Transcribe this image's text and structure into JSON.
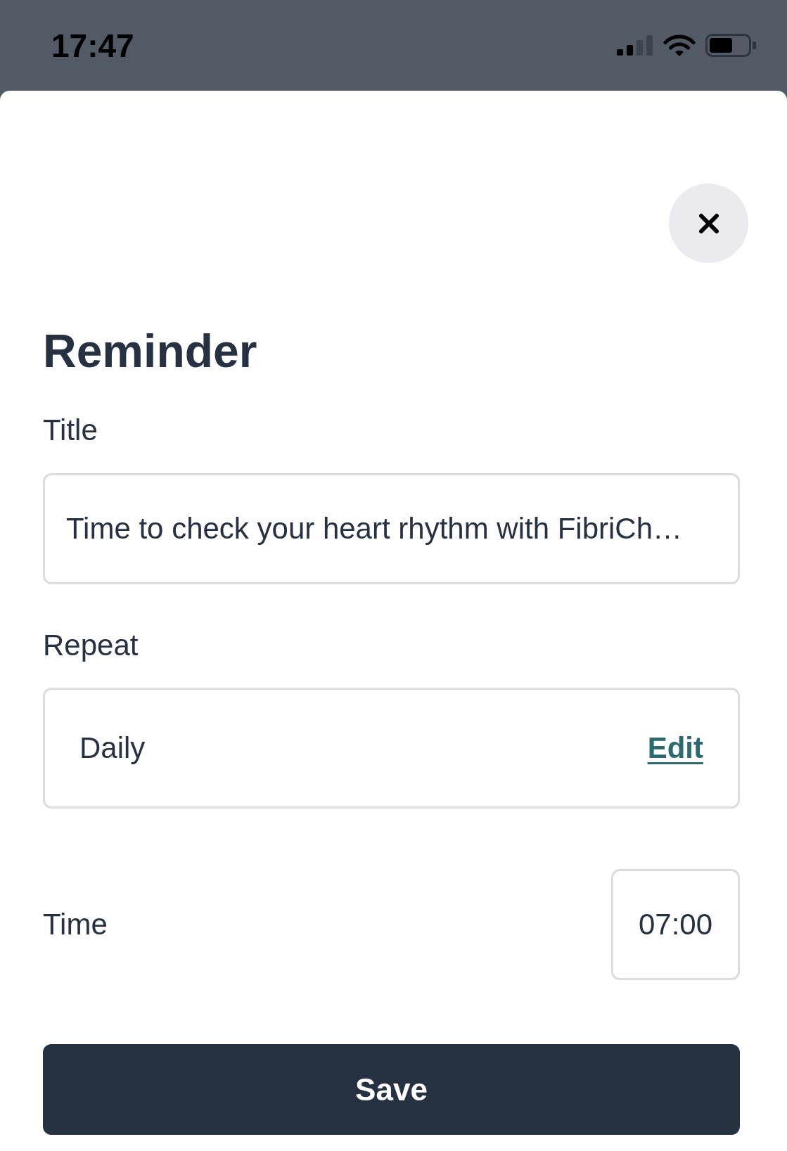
{
  "status_bar": {
    "time": "17:47"
  },
  "title": "Reminder",
  "fields": [
    {
      "kind": "text",
      "label": "Title",
      "value": "Time to check your heart rhythm with FibriCh…"
    },
    {
      "kind": "select",
      "label": "Repeat",
      "value": "Daily",
      "action": "Edit"
    },
    {
      "kind": "time",
      "label": "Time",
      "value": "07:00"
    }
  ],
  "buttons": [
    {
      "label": "Save"
    }
  ]
}
